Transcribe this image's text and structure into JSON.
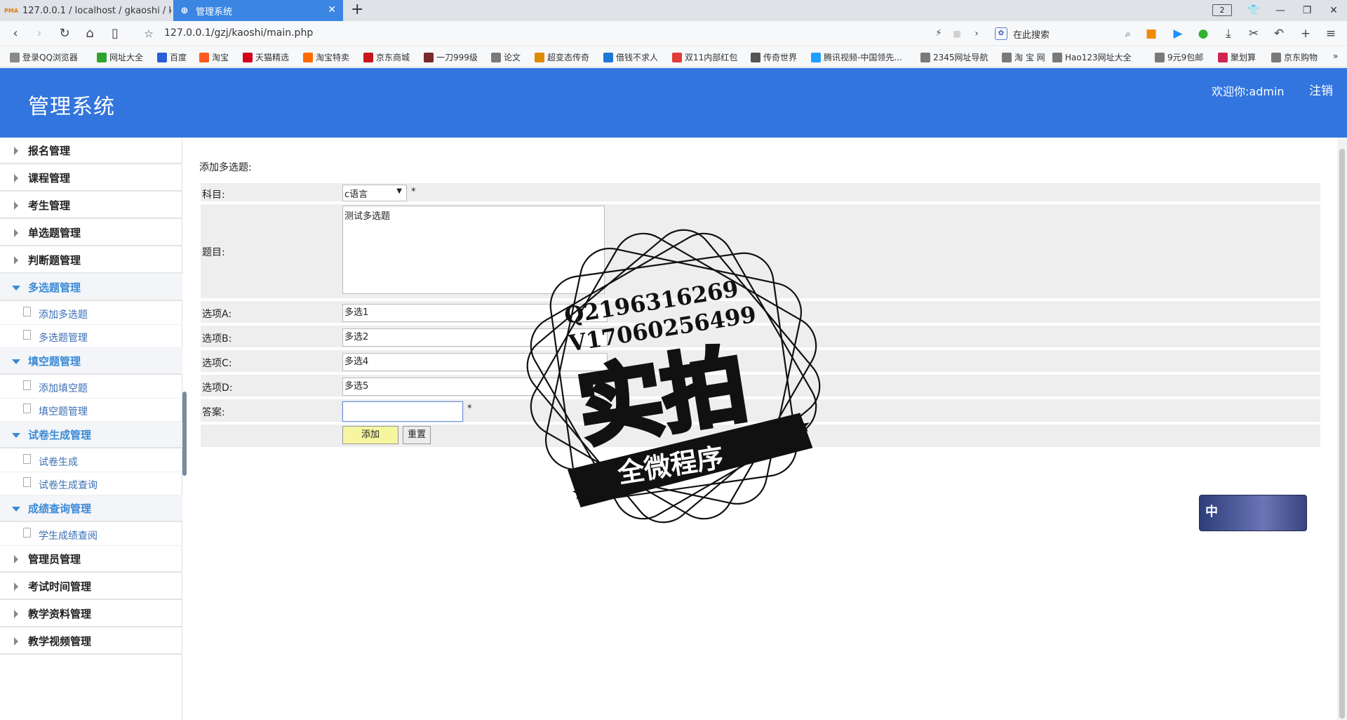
{
  "browser": {
    "tabs": [
      {
        "title": "127.0.0.1 / localhost / gkaoshi / ke",
        "favicon": "PMA"
      },
      {
        "title": "管理系统"
      }
    ],
    "tab_count": "2",
    "url": "127.0.0.1/gzj/kaoshi/main.php",
    "search_placeholder": "在此搜索",
    "bookmarks": [
      {
        "label": "登录QQ浏览器",
        "color": "#8a8a8a"
      },
      {
        "label": "网址大全",
        "color": "#2ea32e"
      },
      {
        "label": "百度",
        "color": "#2b5fd8"
      },
      {
        "label": "淘宝",
        "color": "#ff5a1f"
      },
      {
        "label": "天猫精选",
        "color": "#d2001d"
      },
      {
        "label": "淘宝特卖",
        "color": "#ff6a00"
      },
      {
        "label": "京东商城",
        "color": "#c8161d"
      },
      {
        "label": "一刀999级",
        "color": "#7a2a2a"
      },
      {
        "label": "论文",
        "color": "#7a7a7a"
      },
      {
        "label": "超变态传奇",
        "color": "#e08a00"
      },
      {
        "label": "借钱不求人",
        "color": "#1e78d8"
      },
      {
        "label": "双11内部红包",
        "color": "#e33a3a"
      },
      {
        "label": "传奇世界",
        "color": "#555555"
      },
      {
        "label": "腾讯视频-中国领先...",
        "color": "#20a0ff"
      },
      {
        "label": "2345网址导航",
        "color": "#7a7a7a"
      },
      {
        "label": "淘 宝 网",
        "color": "#7a7a7a"
      },
      {
        "label": "Hao123网址大全",
        "color": "#7a7a7a"
      },
      {
        "label": "9元9包邮",
        "color": "#7a7a7a"
      },
      {
        "label": "聚划算",
        "color": "#d1264f"
      },
      {
        "label": "京东购物",
        "color": "#7a7a7a"
      }
    ]
  },
  "app": {
    "title": "管理系统",
    "welcome_prefix": "欢迎你:",
    "username": "admin",
    "logout": "注销",
    "header_color": "#3275de"
  },
  "sidebar": {
    "sections": [
      {
        "label": "报名管理",
        "open": false
      },
      {
        "label": "课程管理",
        "open": false
      },
      {
        "label": "考生管理",
        "open": false
      },
      {
        "label": "单选题管理",
        "open": false
      },
      {
        "label": "判断题管理",
        "open": false
      },
      {
        "label": "多选题管理",
        "open": true,
        "items": [
          "添加多选题",
          "多选题管理"
        ]
      },
      {
        "label": "填空题管理",
        "open": true,
        "items": [
          "添加填空题",
          "填空题管理"
        ]
      },
      {
        "label": "试卷生成管理",
        "open": true,
        "items": [
          "试卷生成",
          "试卷生成查询"
        ]
      },
      {
        "label": "成绩查询管理",
        "open": true,
        "items": [
          "学生成绩查阅"
        ]
      },
      {
        "label": "管理员管理",
        "open": false
      },
      {
        "label": "考试时间管理",
        "open": false
      },
      {
        "label": "教学资料管理",
        "open": false
      },
      {
        "label": "教学视频管理",
        "open": false
      }
    ]
  },
  "form": {
    "title": "添加多选题:",
    "subject_label": "科目:",
    "subject_value": "c语言",
    "question_label": "题目:",
    "question_value": "测试多选题",
    "option_a_label": "选项A:",
    "option_a_value": "多选1",
    "option_b_label": "选项B:",
    "option_b_value": "多选2",
    "option_c_label": "选项C:",
    "option_c_value": "多选4",
    "option_d_label": "选项D:",
    "option_d_value": "多选5",
    "answer_label": "答案:",
    "answer_value": "",
    "required_mark": "*",
    "add_button": "添加",
    "reset_button": "重置"
  },
  "watermark": {
    "qq": "Q2196316269",
    "wechat": "V17060256499",
    "big_text": "实拍",
    "banner_text": "全微程序"
  },
  "ime_widget": {
    "label": "中"
  }
}
